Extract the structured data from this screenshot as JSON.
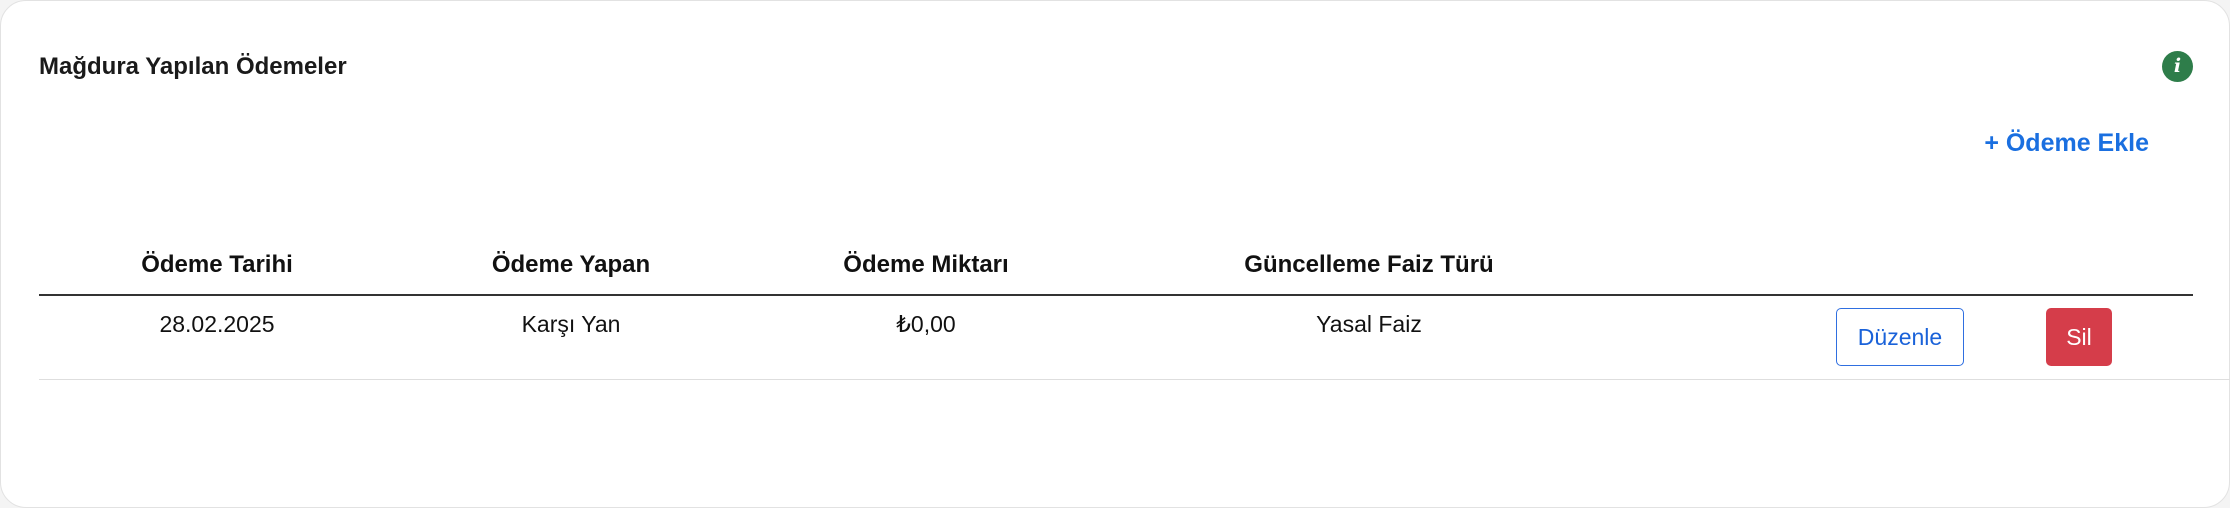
{
  "section": {
    "title": "Mağdura Yapılan Ödemeler",
    "info_icon": "i",
    "add_label": "+ Ödeme Ekle"
  },
  "table": {
    "headers": [
      "Ödeme Tarihi",
      "Ödeme Yapan",
      "Ödeme Miktarı",
      "Güncelleme Faiz Türü"
    ],
    "rows": [
      {
        "date": "28.02.2025",
        "payer": "Karşı Yan",
        "amount": "₺0,00",
        "interest_type": "Yasal Faiz",
        "edit_label": "Düzenle",
        "delete_label": "Sil"
      }
    ]
  },
  "colors": {
    "accent": "#1a6fe0",
    "info": "#2e7d4a",
    "danger": "#d53d4a"
  }
}
